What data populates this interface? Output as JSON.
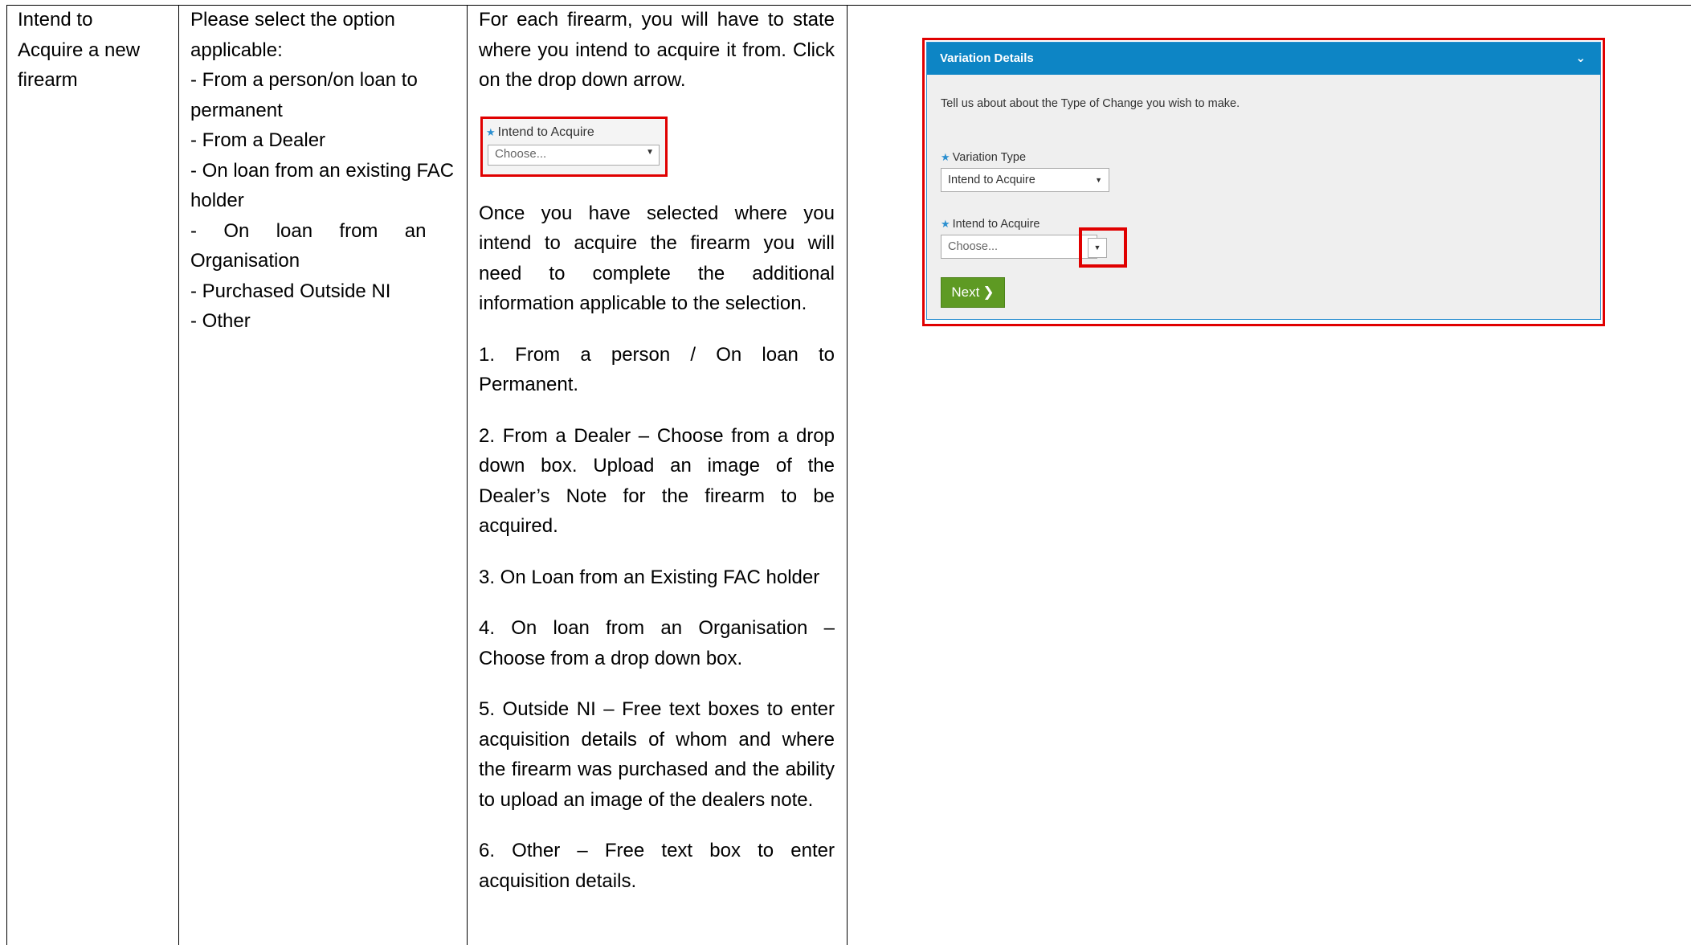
{
  "row": {
    "col1": {
      "lines": [
        "Intend to",
        "Acquire a new",
        "firearm"
      ]
    },
    "col2": {
      "intro": [
        "Please select the option",
        "applicable:"
      ],
      "options": [
        "- From a person/on loan to",
        "permanent",
        "- From a Dealer",
        "- On loan from an existing FAC",
        "holder",
        "-     On     loan     from     an",
        "Organisation",
        "- Purchased Outside NI",
        "- Other"
      ]
    },
    "col3": {
      "p1": "For each firearm, you will have to state where you intend to acquire it from. Click on the drop down arrow.",
      "snippet": {
        "label": "Intend to Acquire",
        "placeholder": "Choose..."
      },
      "p2": "Once you have selected where you intend to acquire the firearm you will need to complete the additional information applicable to the selection.",
      "p3": "1. From a person / On loan to Permanent.",
      "p4": "2. From a Dealer – Choose from a drop down box.  Upload an image of the Dealer’s Note for the firearm to be acquired.",
      "p5": "3. On Loan from an Existing FAC holder",
      "p6": "4. On loan from an Organisation – Choose from a drop down box.",
      "p7": "5. Outside NI – Free text boxes to enter acquisition details of whom and where the firearm was purchased and the ability to upload an image of the dealers note.",
      "p8": "6. Other – Free text box to enter acquisition details."
    }
  },
  "panel": {
    "title": "Variation Details",
    "intro": "Tell us about about the Type of Change you wish to make.",
    "variation_type_label": "Variation Type",
    "variation_type_value": "Intend to Acquire",
    "intend_label": "Intend to Acquire",
    "intend_placeholder": "Choose...",
    "next_label": "Next"
  },
  "colors": {
    "highlight": "#e00000",
    "panel_header": "#0d85c5",
    "next_button": "#5e9a23",
    "required_star": "#2a8fd0"
  }
}
